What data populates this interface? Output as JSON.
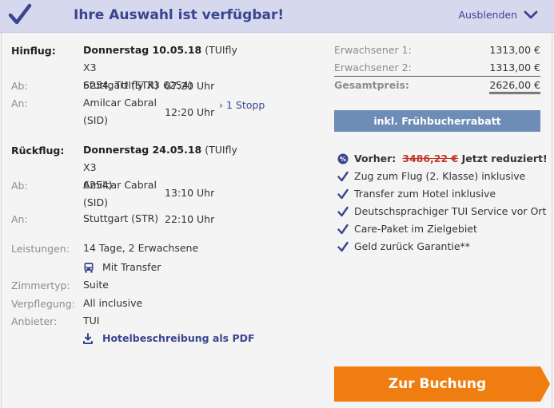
{
  "header": {
    "title": "Ihre Auswahl ist verfügbar!",
    "hide_label": "Ausblenden",
    "icons": [
      "check-icon",
      "chevron-down-icon"
    ]
  },
  "outbound": {
    "label": "Hinflug:",
    "date": "Donnerstag 10.05.18",
    "flight_line1": " (TUIfly X3",
    "flight_line2": "6254, TUIfly X3 6254)",
    "from_label": "Ab:",
    "from": "Stuttgart (STR)",
    "from_time": "07:20 Uhr",
    "to_label": "An:",
    "to_line1": "Amilcar Cabral",
    "to_line2": "(SID)",
    "to_time": "12:20 Uhr",
    "stops": "› 1 Stopp"
  },
  "return": {
    "label": "Rückflug:",
    "date": "Donnerstag 24.05.18",
    "flight_line1": " (TUIfly X3",
    "flight_line2": "6254)",
    "from_label": "Ab:",
    "from_line1": "Amilcar Cabral",
    "from_line2": "(SID)",
    "from_time": "13:10 Uhr",
    "to_label": "An:",
    "to": "Stuttgart (STR)",
    "to_time": "22:10 Uhr"
  },
  "details": {
    "services_label": "Leistungen:",
    "services": "14 Tage, 2 Erwachsene",
    "transfer": "Mit Transfer",
    "room_label": "Zimmertyp:",
    "room": "Suite",
    "board_label": "Verpflegung:",
    "board": "All inclusive",
    "provider_label": "Anbieter:",
    "provider": "TUI",
    "pdf_link": "Hotelbeschreibung als PDF"
  },
  "prices": {
    "adult1_label": "Erwachsener 1:",
    "adult1": "1313,00 €",
    "adult2_label": "Erwachsener 2:",
    "adult2": "1313,00 €",
    "total_label": "Gesamtpreis:",
    "total": "2626,00 €",
    "rabatt_button": "inkl. Frühbucherrabatt"
  },
  "features": {
    "vorher_label": "Vorher:",
    "vorher_price": "3486,22 €",
    "vorher_text": " Jetzt reduziert!",
    "items": [
      "Zug zum Flug (2. Klasse) inklusive",
      "Transfer zum Hotel inklusive",
      "Deutschsprachiger TUI Service vor Ort",
      "Care-Paket im Zielgebiet",
      "Geld zurück Garantie**"
    ]
  },
  "booking_button": "Zur Buchung",
  "colors": {
    "header_bg": "#d6d8ee",
    "brand_blue": "#3a4590",
    "rabatt_bg": "#6e8db6",
    "booking_orange": "#f07d10",
    "strike_red": "#c0392b"
  }
}
